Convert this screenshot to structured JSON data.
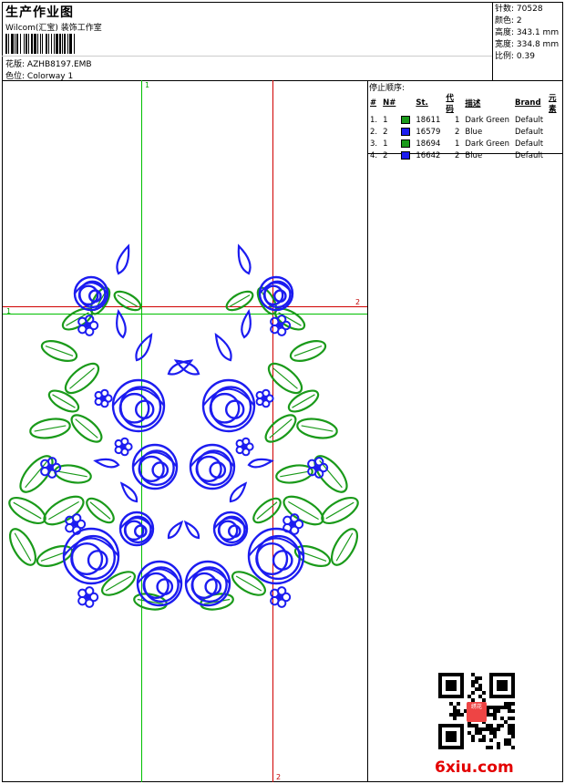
{
  "header": {
    "title": "生产作业图",
    "subtitle": "Wilcom(汇宝) 装饰工作室",
    "design_label": "花版:",
    "design_value": "AZHB8197.EMB",
    "colorway_label": "色位:",
    "colorway_value": "Colorway 1"
  },
  "stats": [
    {
      "label": "针数:",
      "value": "70528"
    },
    {
      "label": "颜色:",
      "value": "2"
    },
    {
      "label": "高度:",
      "value": "343.1 mm"
    },
    {
      "label": "宽度:",
      "value": "334.8 mm"
    },
    {
      "label": "比例:",
      "value": "0.39"
    }
  ],
  "stop_sequence": {
    "heading": "停止顺序:",
    "columns": [
      "#",
      "N#",
      "St.",
      "代码",
      "描述",
      "Brand",
      "元素"
    ],
    "rows": [
      {
        "idx": "1.",
        "n": "1",
        "swatch": "#1a9a1a",
        "st": "18611",
        "code": "1",
        "desc": "Dark Green",
        "brand": "Default"
      },
      {
        "idx": "2.",
        "n": "2",
        "swatch": "#1c1cf0",
        "st": "16579",
        "code": "2",
        "desc": "Blue",
        "brand": "Default"
      },
      {
        "idx": "3.",
        "n": "1",
        "swatch": "#1a9a1a",
        "st": "18694",
        "code": "1",
        "desc": "Dark Green",
        "brand": "Default"
      },
      {
        "idx": "4.",
        "n": "2",
        "swatch": "#1c1cf0",
        "st": "16642",
        "code": "2",
        "desc": "Blue",
        "brand": "Default"
      }
    ]
  },
  "guides": {
    "green_label": "1",
    "red_label": "2"
  },
  "colors": {
    "green": "#1a9a1a",
    "blue": "#1c1cf0",
    "guide_green": "#00c000",
    "guide_red": "#d00000"
  },
  "watermark": {
    "brand_text": "6xiu.com",
    "stamp_text": "绣花"
  }
}
